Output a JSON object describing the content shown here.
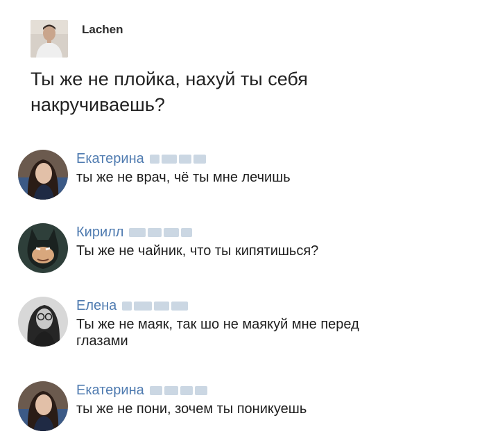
{
  "post": {
    "author": "Lachen",
    "text": "Ты же не плойка, нахуй ты себя накручиваешь?"
  },
  "comments": [
    {
      "name": "Екатерина",
      "text": "ты же не врач, чё ты мне лечишь",
      "avatar_icon": "woman-avatar-icon"
    },
    {
      "name": "Кирилл",
      "text": "Ты же не чайник, что ты кипятишься?",
      "avatar_icon": "batman-avatar-icon"
    },
    {
      "name": "Елена",
      "text": "Ты же не маяк, так шо не маякуй мне перед глазами",
      "avatar_icon": "woman-glasses-avatar-icon"
    },
    {
      "name": "Екатерина",
      "text": "ты же не пони, зочем ты поникуешь",
      "avatar_icon": "woman-avatar-icon"
    }
  ],
  "colors": {
    "name": "#4f7bb0",
    "blur": "#b9c9da"
  }
}
